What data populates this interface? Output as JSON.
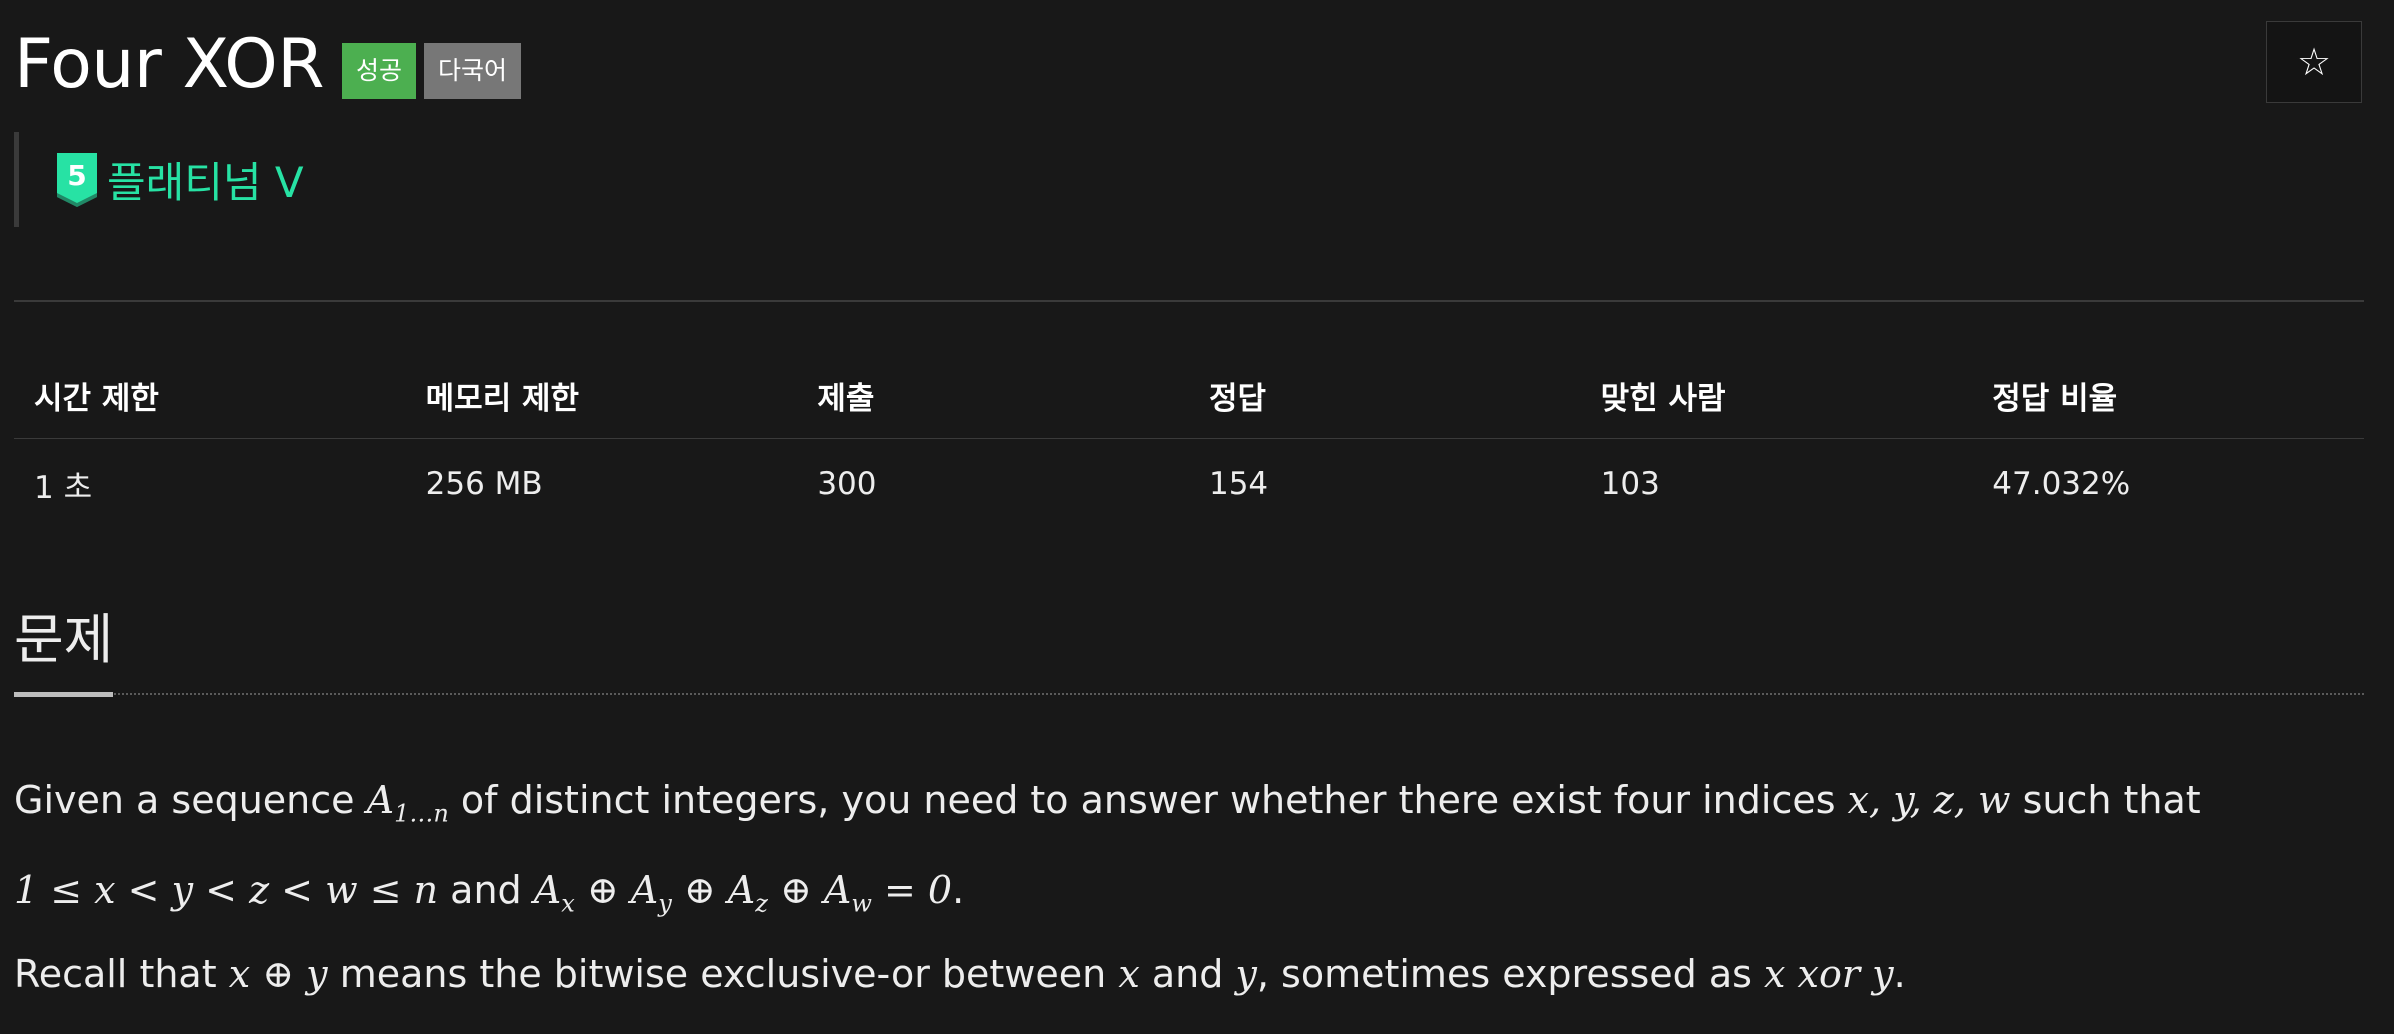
{
  "problem": {
    "title": "Four XOR",
    "labels": {
      "success": "성공",
      "multilang": "다국어"
    },
    "tier": {
      "level": "5",
      "name": "플래티넘 V",
      "color": "#27e2a4"
    },
    "star": "☆"
  },
  "stats": {
    "headers": [
      "시간 제한",
      "메모리 제한",
      "제출",
      "정답",
      "맞힌 사람",
      "정답 비율"
    ],
    "values": [
      "1 초",
      "256 MB",
      "300",
      "154",
      "103",
      "47.032%"
    ]
  },
  "section": {
    "title": "문제"
  },
  "statement": {
    "p1_a": "Given a sequence ",
    "p1_seq_base": "A",
    "p1_seq_sub": "1…n",
    "p1_b": " of distinct integers, you need to answer whether there exist four indices ",
    "p1_vars": "x, y, z, w",
    "p1_c": " such that",
    "p2_ineq": "1 ≤ x < y < z < w ≤ n",
    "p2_and": " and ",
    "p2_expr": "A",
    "p2_s1": "x",
    "p2_op1": " ⊕ A",
    "p2_s2": "y",
    "p2_op2": " ⊕ A",
    "p2_s3": "z",
    "p2_op3": " ⊕ A",
    "p2_s4": "w",
    "p2_eq": " = 0",
    "p2_end": ".",
    "p3_a": "Recall that ",
    "p3_xor": "x ⊕ y",
    "p3_b": " means the bitwise exclusive-or between ",
    "p3_x": "x",
    "p3_c": " and ",
    "p3_y": "y",
    "p3_d": ", sometimes expressed as ",
    "p3_xory": "x xor y",
    "p3_end": "."
  }
}
